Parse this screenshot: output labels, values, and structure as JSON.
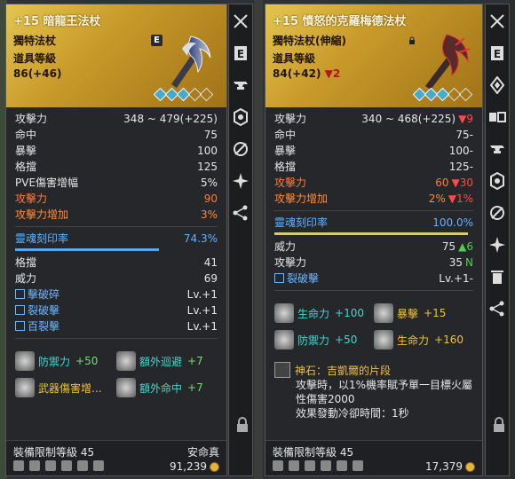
{
  "left": {
    "title": "+15 暗龍王法杖",
    "type": "獨特法杖",
    "level_label": "道具等級",
    "level_value": "86(+46)",
    "badge": "E",
    "stats": [
      {
        "k": "攻擊力",
        "v": "348 ~ 479(+225)"
      },
      {
        "k": "命中",
        "v": "75"
      },
      {
        "k": "暴擊",
        "v": "100"
      },
      {
        "k": "格擋",
        "v": "125"
      },
      {
        "k": "PVE傷害增幅",
        "v": "5%"
      },
      {
        "k": "攻擊力",
        "v": "90"
      },
      {
        "k": "攻擊力增加",
        "v": "3%"
      }
    ],
    "soul": {
      "k": "靈魂刻印率",
      "v": "74.3%"
    },
    "soul_fill": 0.743,
    "soul_stats": [
      {
        "k": "格擋",
        "v": "41"
      },
      {
        "k": "威力",
        "v": "69"
      }
    ],
    "skills": [
      {
        "k": "擊破碎",
        "v": "Lv.+1"
      },
      {
        "k": "裂破擊",
        "v": "Lv.+1"
      },
      {
        "k": "百裂擊",
        "v": "Lv.+1"
      }
    ],
    "bonuses": [
      {
        "label": "防禦力",
        "value": "+50"
      },
      {
        "label": "額外迴避",
        "value": "+7"
      },
      {
        "label": "武器傷害增...",
        "value": ""
      },
      {
        "label": "額外命中",
        "value": "+7"
      }
    ],
    "footer": {
      "limit": "裝備限制等級 45",
      "seller": "安命真",
      "price": "91,239"
    }
  },
  "right": {
    "title": "+15 憤怒的克羅梅德法杖",
    "type": "獨特法杖(伸縮)",
    "level_label": "道具等級",
    "level_value": "84(+42)",
    "level_diff": "▼2",
    "badge": "E",
    "stats": [
      {
        "k": "攻擊力",
        "v": "340 ~ 468(+225)",
        "d": "▼9"
      },
      {
        "k": "命中",
        "v": "75",
        "d": "-"
      },
      {
        "k": "暴擊",
        "v": "100",
        "d": "-"
      },
      {
        "k": "格擋",
        "v": "125",
        "d": "-"
      },
      {
        "k": "攻擊力",
        "v": "60",
        "d": "▼30"
      },
      {
        "k": "攻擊力增加",
        "v": "2%",
        "d": "▼1%"
      }
    ],
    "soul": {
      "k": "靈魂刻印率",
      "v": "100.0%"
    },
    "soul_fill": 1.0,
    "soul_stats": [
      {
        "k": "威力",
        "v": "75",
        "d": "▲6"
      },
      {
        "k": "攻擊力",
        "v": "35",
        "d": "N"
      }
    ],
    "skills": [
      {
        "k": "裂破擊",
        "v": "Lv.+1",
        "d": "-"
      }
    ],
    "bonuses": [
      {
        "label": "生命力",
        "value": "+100"
      },
      {
        "label": "暴擊",
        "value": "+15"
      },
      {
        "label": "防禦力",
        "value": "+50"
      },
      {
        "label": "生命力",
        "value": "+160"
      }
    ],
    "godstone": {
      "title": "神石：吉凱爾的片段",
      "lines": [
        "攻擊時，以1%機率賦予單一目標火屬",
        "性傷害2000",
        "效果發動冷卻時間：1秒"
      ]
    },
    "footer": {
      "limit": "裝備限制等級 45",
      "price": "17,379"
    }
  }
}
